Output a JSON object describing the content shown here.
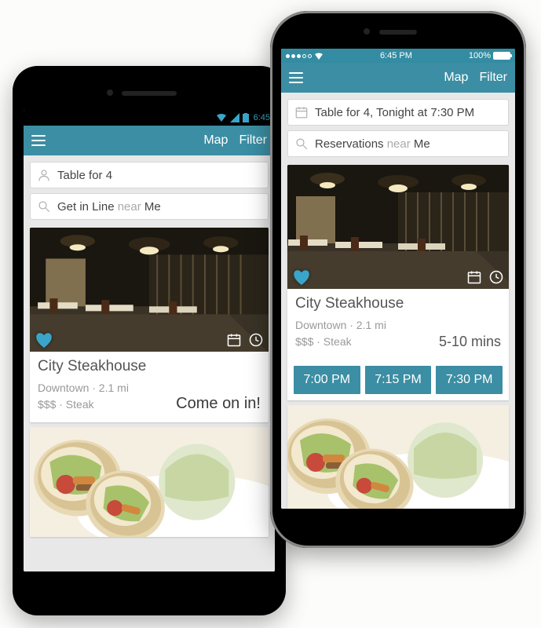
{
  "android": {
    "status": {
      "time": "6:45"
    },
    "header": {
      "map": "Map",
      "filter": "Filter"
    },
    "search": {
      "row1": "Table for 4",
      "row2_prefix": "Get in Line ",
      "row2_mid": "near ",
      "row2_suffix": "Me"
    },
    "card1": {
      "title": "City Steakhouse",
      "meta_line1": "Downtown · 2.1 mi",
      "meta_line2": "$$$ · Steak",
      "status": "Come on in!"
    }
  },
  "ios": {
    "status": {
      "time": "6:45 PM",
      "battery": "100%"
    },
    "header": {
      "map": "Map",
      "filter": "Filter"
    },
    "search": {
      "row1": "Table for 4, Tonight at 7:30 PM",
      "row2_prefix": "Reservations ",
      "row2_mid": "near ",
      "row2_suffix": "Me"
    },
    "card1": {
      "title": "City Steakhouse",
      "meta_line1": "Downtown · 2.1 mi",
      "meta_line2": "$$$ · Steak",
      "wait": "5-10 mins",
      "slots": [
        "7:00 PM",
        "7:15 PM",
        "7:30 PM"
      ]
    }
  }
}
